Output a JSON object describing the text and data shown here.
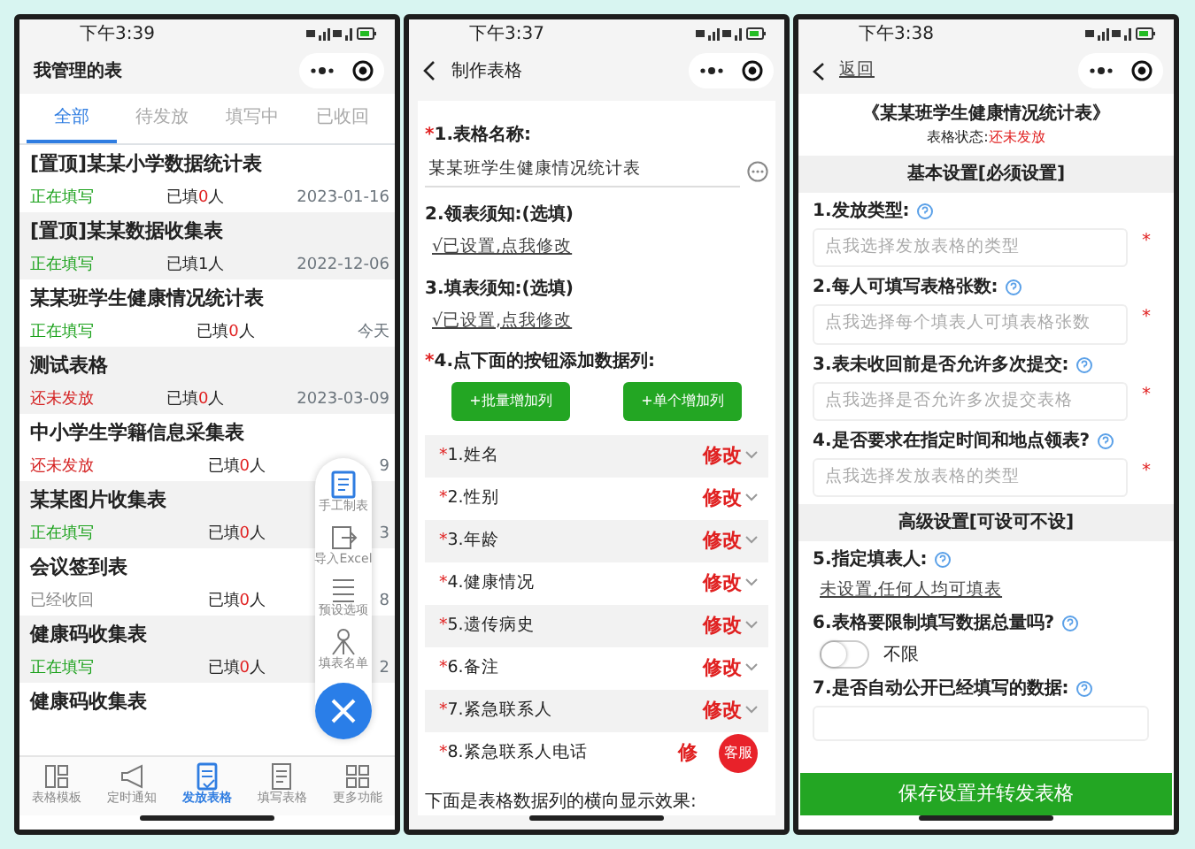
{
  "list_screen": {
    "status_time": "下午3:39",
    "title": "我管理的表",
    "tabs": [
      {
        "label": "全部",
        "selected": true
      },
      {
        "label": "待发放",
        "selected": false
      },
      {
        "label": "填写中",
        "selected": false
      },
      {
        "label": "已收回",
        "selected": false
      }
    ],
    "rows": [
      {
        "title": "[置顶]某某小学数据统计表",
        "status": "正在填写",
        "color": "#1aa11a",
        "filled": [
          "已填",
          "0",
          "人"
        ],
        "count_highlight": true,
        "date": "2023-01-16"
      },
      {
        "title": "[置顶]某某数据收集表",
        "status": "正在填写",
        "color": "#1aa11a",
        "filled": [
          "已填",
          "1",
          "人"
        ],
        "count_highlight": false,
        "date": "2022-12-06"
      },
      {
        "title": "某某班学生健康情况统计表",
        "status": "正在填写",
        "color": "#1aa11a",
        "filled": [
          "已填",
          "0",
          "人"
        ],
        "count_highlight": true,
        "date": "今天"
      },
      {
        "title": "测试表格",
        "status": "还未发放",
        "color": "#d42020",
        "filled": [
          "已填",
          "0",
          "人"
        ],
        "count_highlight": true,
        "date": "2023-03-09"
      },
      {
        "title": "中小学生学籍信息采集表",
        "status": "还未发放",
        "color": "#d42020",
        "filled": [
          "已填",
          "0",
          "人"
        ],
        "count_highlight": true,
        "date": "9"
      },
      {
        "title": "某某图片收集表",
        "status": "正在填写",
        "color": "#1aa11a",
        "filled": [
          "已填",
          "0",
          "人"
        ],
        "count_highlight": true,
        "date": "3"
      },
      {
        "title": "会议签到表",
        "status": "已经收回",
        "color": "#888888",
        "filled": [
          "已填",
          "0",
          "人"
        ],
        "count_highlight": true,
        "date": "8"
      },
      {
        "title": "健康码收集表",
        "status": "正在填写",
        "color": "#1aa11a",
        "filled": [
          "已填",
          "0",
          "人"
        ],
        "count_highlight": true,
        "date": "2"
      },
      {
        "title": "健康码收集表"
      }
    ],
    "fab_menu": [
      {
        "label": "手工制表"
      },
      {
        "label": "导入Excel"
      },
      {
        "label": "预设选项"
      },
      {
        "label": "填表名单"
      }
    ],
    "nav": [
      {
        "label": "表格模板",
        "selected": false
      },
      {
        "label": "定时通知",
        "selected": false
      },
      {
        "label": "发放表格",
        "selected": true
      },
      {
        "label": "填写表格",
        "selected": false
      },
      {
        "label": "更多功能",
        "selected": false
      }
    ]
  },
  "editor_screen": {
    "status_time": "下午3:37",
    "title": "制作表格",
    "name_field": {
      "mark": "*",
      "label": "1.表格名称:",
      "value": "某某班学生健康情况统计表"
    },
    "notes": [
      {
        "label": "2.领表须知:(选填)",
        "link": "√已设置,点我修改"
      },
      {
        "label": "3.填表须知:(选填)",
        "link": "√已设置,点我修改"
      }
    ],
    "columns_heading": {
      "mark": "*",
      "label": "4.点下面的按钮添加数据列:"
    },
    "buttons": [
      "+批量增加列",
      "+单个增加列"
    ],
    "columns": [
      {
        "mark": "*",
        "label": "1.姓名",
        "action": "修改",
        "chevron": true
      },
      {
        "mark": "*",
        "label": "2.性别",
        "action": "修改",
        "chevron": true
      },
      {
        "mark": "*",
        "label": "3.年龄",
        "action": "修改",
        "chevron": true
      },
      {
        "mark": "*",
        "label": "4.健康情况",
        "action": "修改",
        "chevron": true
      },
      {
        "mark": "*",
        "label": "5.遗传病史",
        "action": "修改",
        "chevron": true
      },
      {
        "mark": "*",
        "label": "6.备注",
        "action": "修改",
        "chevron": true
      },
      {
        "mark": "*",
        "label": "7.紧急联系人",
        "action": "修改",
        "chevron": true
      },
      {
        "mark": "*",
        "label": "8.紧急联系人电话",
        "action": "修",
        "chevron": false
      }
    ],
    "service_bubble": "客服",
    "footer": "下面是表格数据列的横向显示效果:"
  },
  "settings_screen": {
    "status_time": "下午3:38",
    "back": "返回",
    "title": "《某某班学生健康情况统计表》",
    "status_label": "表格状态:",
    "status_value": "还未发放",
    "sections": [
      {
        "heading": "基本设置[必须设置]",
        "items": [
          {
            "kind": "select",
            "label": "1.发放类型:",
            "placeholder": "点我选择发放表格的类型",
            "mark": "*"
          },
          {
            "kind": "select",
            "label": "2.每人可填写表格张数:",
            "placeholder": "点我选择每个填表人可填表格张数",
            "mark": "*"
          },
          {
            "kind": "select",
            "label": "3.表未收回前是否允许多次提交:",
            "placeholder": "点我选择是否允许多次提交表格",
            "mark": "*"
          },
          {
            "kind": "select",
            "label": "4.是否要求在指定时间和地点领表?",
            "placeholder": "点我选择发放表格的类型",
            "mark": "*"
          }
        ]
      },
      {
        "heading": "高级设置[可设可不设]",
        "items": [
          {
            "kind": "link",
            "label": "5.指定填表人:",
            "link": "未设置,任何人均可填表"
          },
          {
            "kind": "toggle",
            "label": "6.表格要限制填写数据总量吗?",
            "on": false,
            "text": "不限"
          },
          {
            "kind": "select",
            "label": "7.是否自动公开已经填写的数据:"
          }
        ]
      }
    ],
    "save_button": "保存设置并转发表格"
  }
}
